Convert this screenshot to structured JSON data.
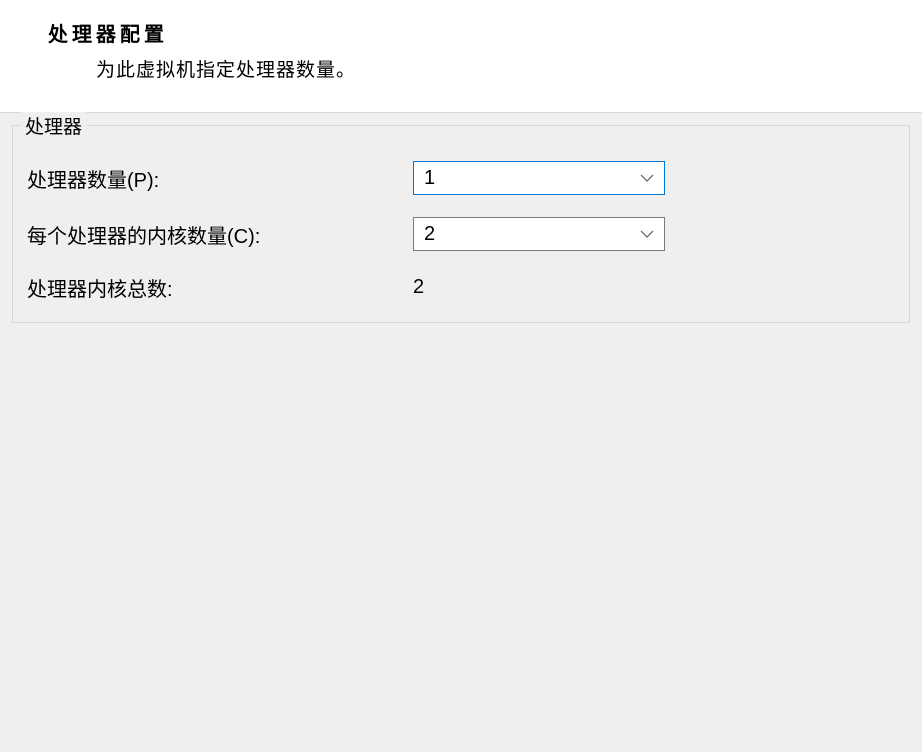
{
  "header": {
    "title": "处理器配置",
    "description": "为此虚拟机指定处理器数量。"
  },
  "group": {
    "legend": "处理器",
    "rows": {
      "processor_count": {
        "label": "处理器数量(P):",
        "value": "1"
      },
      "cores_per_processor": {
        "label": "每个处理器的内核数量(C):",
        "value": "2"
      },
      "total_cores": {
        "label": "处理器内核总数:",
        "value": "2"
      }
    }
  }
}
